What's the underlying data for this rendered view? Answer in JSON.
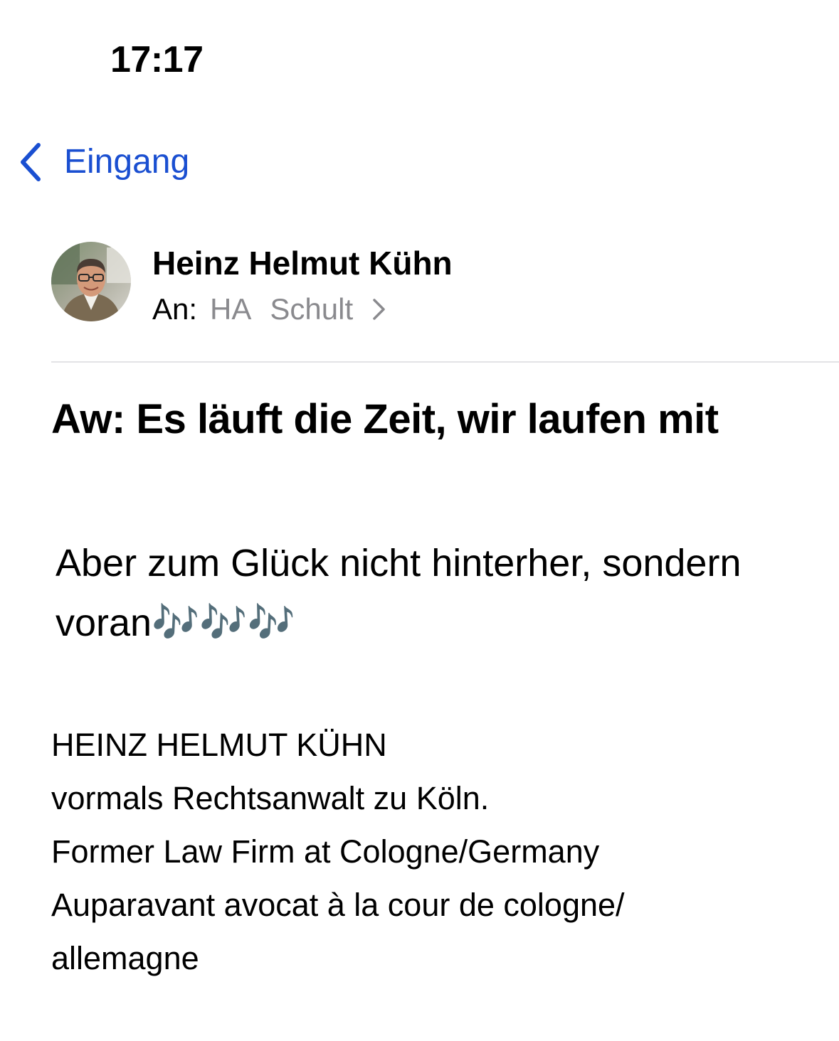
{
  "accent_color": "#1a4fd1",
  "status_bar": {
    "time": "17:17"
  },
  "nav": {
    "back_icon": "chevron-left-icon",
    "back_label": "Eingang"
  },
  "message": {
    "sender_name": "Heinz Helmut Kühn",
    "to_label": "An:",
    "recipients": [
      "HA",
      "Schult"
    ],
    "recipients_chevron_icon": "chevron-right-icon",
    "subject": "Aw: Es läuft die Zeit, wir laufen mit",
    "body": "Aber zum Glück nicht hinterher, sondern voran🎶🎶🎶",
    "signature": [
      "HEINZ HELMUT KÜHN",
      "vormals Rechtsanwalt zu Köln.",
      "Former Law Firm at Cologne/Germany",
      "Auparavant avocat à la cour de cologne/",
      "allemagne"
    ]
  }
}
